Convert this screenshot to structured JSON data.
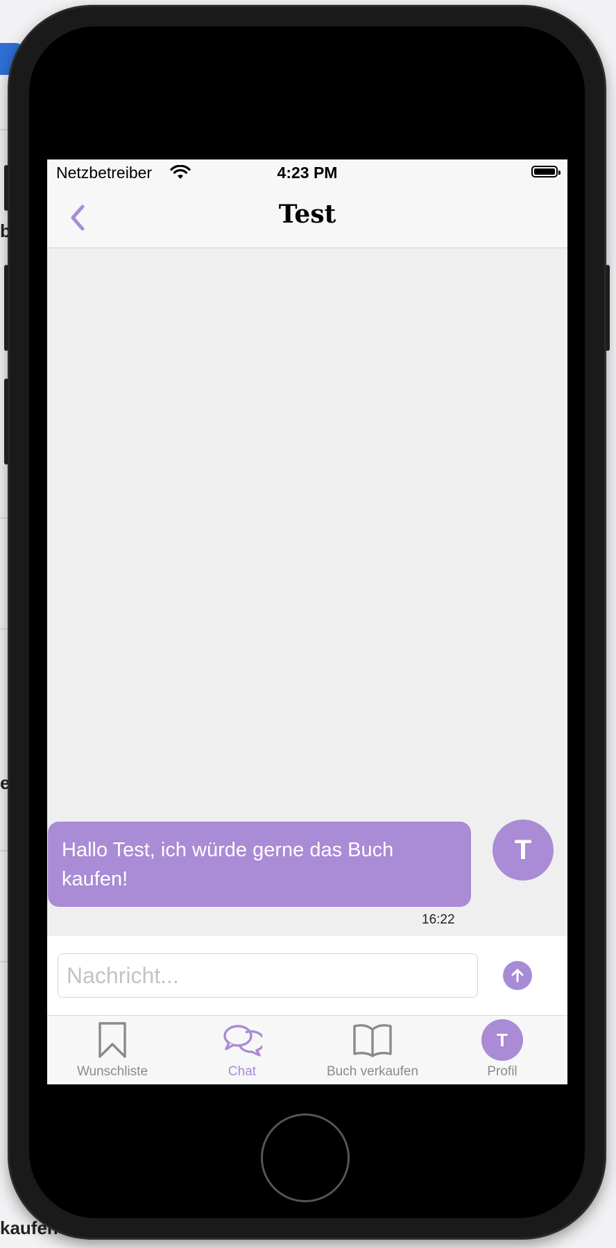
{
  "background_app": {
    "fragment_1": "be",
    "fragment_2": "e",
    "fragment_3": "kaufen"
  },
  "status_bar": {
    "carrier": "Netzbetreiber",
    "time": "4:23 PM"
  },
  "nav": {
    "title": "Test"
  },
  "messages": [
    {
      "text": "Hallo Test, ich würde gerne das Buch kaufen!",
      "time": "16:22",
      "avatar_initial": "T"
    }
  ],
  "composer": {
    "placeholder": "Nachricht...",
    "value": ""
  },
  "tabs": [
    {
      "label": "Wunschliste",
      "icon": "bookmark-icon",
      "active": false
    },
    {
      "label": "Chat",
      "icon": "chat-bubbles-icon",
      "active": true
    },
    {
      "label": "Buch verkaufen",
      "icon": "open-book-icon",
      "active": false
    },
    {
      "label": "Profil",
      "icon": "profile-avatar",
      "initial": "T",
      "active": false
    }
  ],
  "colors": {
    "accent": "#aa8bd6",
    "inactive_tab": "#8a8a8a",
    "chat_background": "#efefef"
  }
}
